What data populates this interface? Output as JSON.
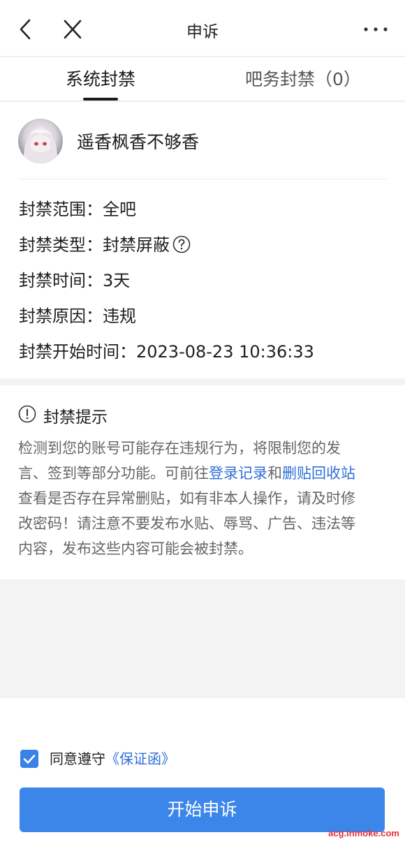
{
  "navbar": {
    "title": "申诉",
    "back_icon": "chevron-left-icon",
    "close_icon": "close-icon",
    "more_icon": "more-horizontal-icon"
  },
  "tabs": [
    {
      "label": "系统封禁",
      "active": true
    },
    {
      "label": "吧务封禁（0）",
      "active": false
    }
  ],
  "profile": {
    "username": "遥香枫香不够香"
  },
  "ban_info": {
    "scope": "封禁范围：全吧",
    "type": "封禁类型：封禁屏蔽",
    "duration": "封禁时间：3天",
    "reason": "封禁原因：违规",
    "start_time": "封禁开始时间：2023-08-23 10:36:33"
  },
  "notice": {
    "title": "封禁提示",
    "line1": "检测到您的账号可能存在违规行为，将限制您的发",
    "line2_prefix": "言、签到等部分功能。可前往",
    "link_login": "登录记录",
    "line2_and": "和",
    "link_recycle": "删贴回收站",
    "line3": "查看是否存在异常删贴，如有非本人操作，请及时修",
    "line4": "改密码！请注意不要发布水贴、辱骂、广告、违法等",
    "line5": "内容，发布这些内容可能会被封禁。"
  },
  "agreement": {
    "checked": true,
    "text": "同意遵守",
    "link": "《保证函》"
  },
  "start_button": {
    "label": "开始申诉"
  },
  "watermark": "acg.inmoke.com",
  "colors": {
    "accent": "#3c86ea",
    "link": "#2f6fd8"
  }
}
